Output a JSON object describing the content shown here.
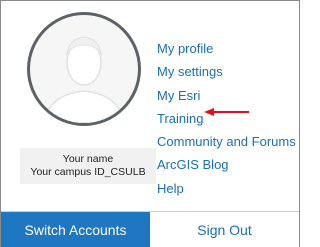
{
  "user": {
    "name": "Your name",
    "campus_id": "Your campus ID_CSULB"
  },
  "menu": {
    "items": [
      {
        "label": "My profile"
      },
      {
        "label": "My settings"
      },
      {
        "label": "My Esri"
      },
      {
        "label": "Training"
      },
      {
        "label": "Community and Forums"
      },
      {
        "label": "ArcGIS Blog"
      },
      {
        "label": "Help"
      }
    ]
  },
  "annotation": {
    "color": "#e0101a",
    "points_to": "Training"
  },
  "buttons": {
    "switch_accounts": "Switch Accounts",
    "sign_out": "Sign Out"
  },
  "colors": {
    "link": "#1a6fb5",
    "primary_button": "#1f77c1",
    "avatar_ring": "#5d6268"
  }
}
